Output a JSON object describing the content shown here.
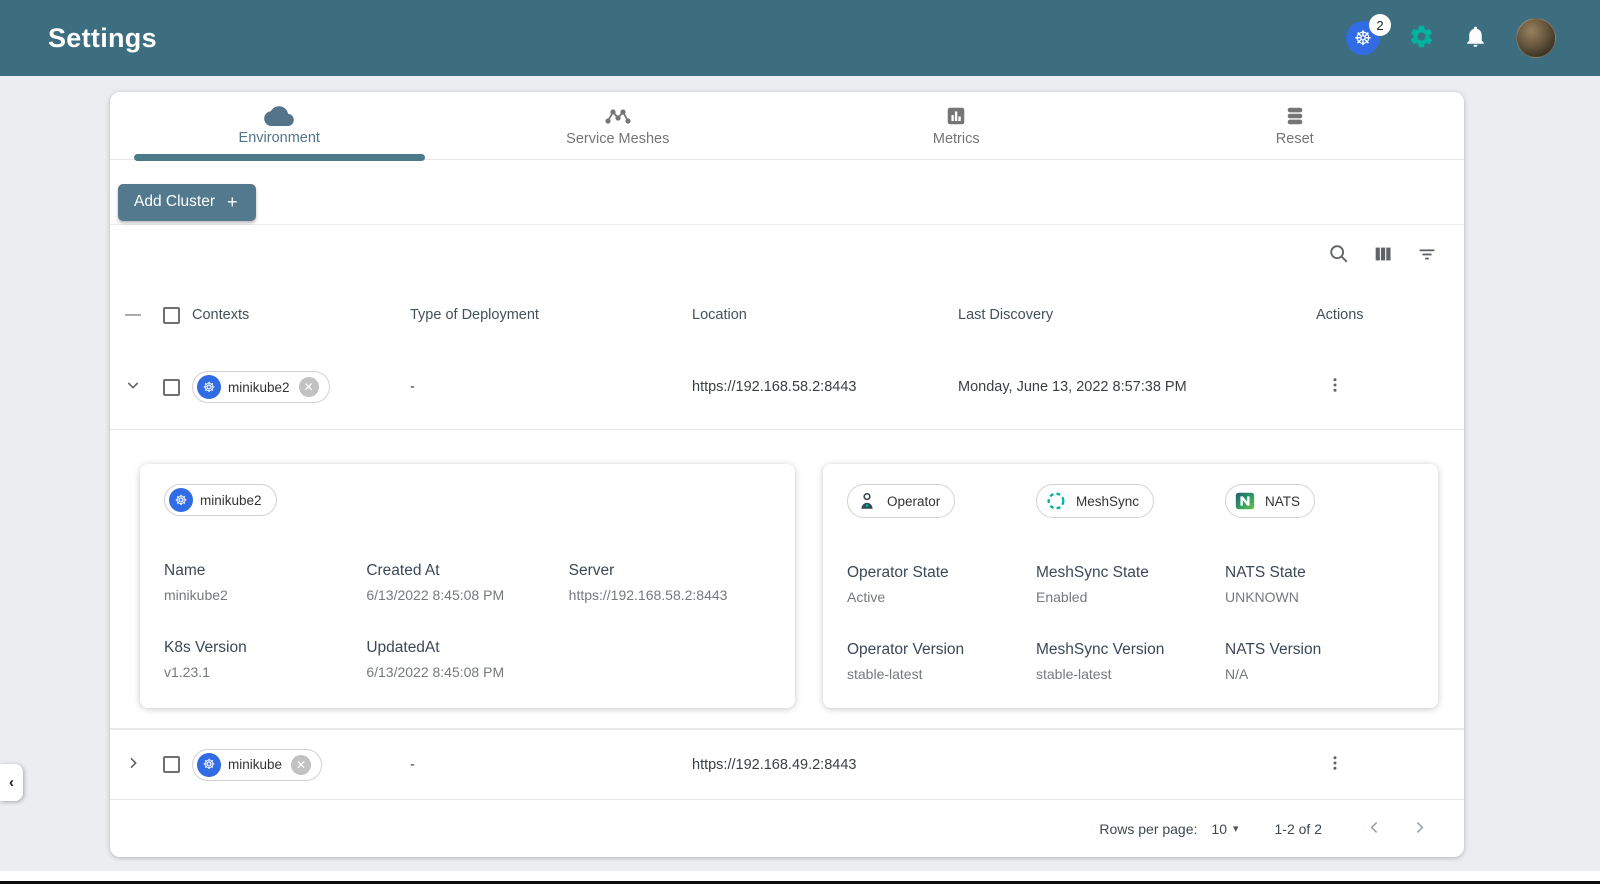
{
  "colors": {
    "header_bg": "#3C6E80",
    "accent_green": "#00B39F",
    "k8s_blue": "#326CE5",
    "button_bg": "#53798E",
    "tab_indicator": "#4C7A8A"
  },
  "icons": {
    "plus": "+",
    "collapse_minus": "—",
    "k8s_wheel": "☸",
    "chip_close": "✕",
    "caret_down": "▾",
    "panel_collapse": "‹"
  },
  "header": {
    "title": "Settings",
    "k8s_context_badge": "2"
  },
  "tabs": [
    {
      "label": "Environment"
    },
    {
      "label": "Service Meshes"
    },
    {
      "label": "Metrics"
    },
    {
      "label": "Reset"
    }
  ],
  "toolbar": {
    "add_cluster_label": "Add Cluster"
  },
  "table": {
    "columns": {
      "contexts": "Contexts",
      "type": "Type of Deployment",
      "location": "Location",
      "last_discovery": "Last Discovery",
      "actions": "Actions"
    },
    "rows": [
      {
        "name": "minikube2",
        "type": "-",
        "location": "https://192.168.58.2:8443",
        "last_discovery": "Monday, June 13, 2022 8:57:38 PM"
      },
      {
        "name": "minikube",
        "type": "-",
        "location": "https://192.168.49.2:8443",
        "last_discovery": ""
      }
    ]
  },
  "details": {
    "chip": "minikube2",
    "fields": {
      "name": {
        "label": "Name",
        "value": "minikube2"
      },
      "created": {
        "label": "Created At",
        "value": "6/13/2022 8:45:08 PM"
      },
      "server": {
        "label": "Server",
        "value": "https://192.168.58.2:8443"
      },
      "k8s": {
        "label": "K8s Version",
        "value": "v1.23.1"
      },
      "updated": {
        "label": "UpdatedAt",
        "value": "6/13/2022 8:45:08 PM"
      }
    }
  },
  "operator_panel": {
    "chips": {
      "operator": "Operator",
      "meshsync": "MeshSync",
      "nats": "NATS"
    },
    "fields": {
      "op_state": {
        "label": "Operator State",
        "value": "Active"
      },
      "ms_state": {
        "label": "MeshSync State",
        "value": "Enabled"
      },
      "nats_state": {
        "label": "NATS State",
        "value": "UNKNOWN"
      },
      "op_ver": {
        "label": "Operator Version",
        "value": "stable-latest"
      },
      "ms_ver": {
        "label": "MeshSync Version",
        "value": "stable-latest"
      },
      "nats_ver": {
        "label": "NATS Version",
        "value": "N/A"
      }
    }
  },
  "pagination": {
    "rows_per_page_label": "Rows per page:",
    "rows_per_page": "10",
    "range": "1-2 of 2"
  }
}
